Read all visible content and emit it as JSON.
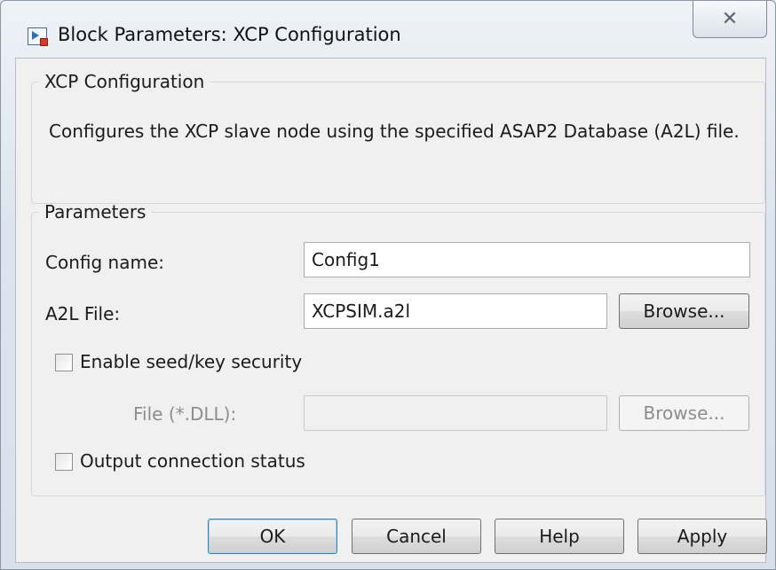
{
  "window": {
    "title": "Block Parameters: XCP Configuration",
    "close_glyph": "✕"
  },
  "description_group": {
    "legend": "XCP Configuration",
    "text": "Configures the XCP slave node using the specified ASAP2 Database (A2L) file."
  },
  "parameters_group": {
    "legend": "Parameters",
    "config_name": {
      "label": "Config name:",
      "value": "Config1"
    },
    "a2l_file": {
      "label": "A2L File:",
      "value": "XCPSIM.a2l",
      "browse_label": "Browse..."
    },
    "seed_key": {
      "label": "Enable seed/key security",
      "checked": false
    },
    "dll_file": {
      "label": "File (*.DLL):",
      "value": "",
      "browse_label": "Browse...",
      "enabled": false
    },
    "output_status": {
      "label": "Output connection status",
      "checked": false
    }
  },
  "buttons": {
    "ok": "OK",
    "cancel": "Cancel",
    "help": "Help",
    "apply": "Apply"
  }
}
